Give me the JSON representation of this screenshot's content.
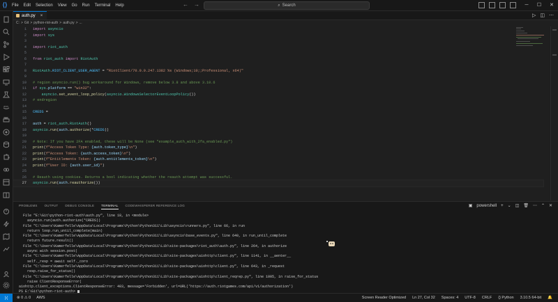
{
  "titlebar": {
    "menu": [
      "File",
      "Edit",
      "Selection",
      "View",
      "Go",
      "Run",
      "Terminal",
      "Help"
    ],
    "search_label": "Search"
  },
  "tab": {
    "filename": "auth.py"
  },
  "breadcrumb": [
    "C:",
    ">",
    "Git",
    ">",
    "python-riot-auth",
    ">",
    "auth.py",
    ">",
    "..."
  ],
  "editor": {
    "lines": [
      {
        "n": "1",
        "tokens": [
          {
            "c": "kw",
            "t": "import "
          },
          {
            "c": "mod",
            "t": "asyncio"
          }
        ]
      },
      {
        "n": "2",
        "tokens": [
          {
            "c": "kw",
            "t": "import "
          },
          {
            "c": "mod",
            "t": "sys"
          }
        ]
      },
      {
        "n": "3",
        "tokens": []
      },
      {
        "n": "4",
        "tokens": [
          {
            "c": "kw",
            "t": "import "
          },
          {
            "c": "mod",
            "t": "riot_auth"
          }
        ]
      },
      {
        "n": "5",
        "tokens": []
      },
      {
        "n": "6",
        "tokens": [
          {
            "c": "kw",
            "t": "from "
          },
          {
            "c": "mod",
            "t": "riot_auth "
          },
          {
            "c": "kw",
            "t": "import "
          },
          {
            "c": "mod",
            "t": "RiotAuth"
          }
        ]
      },
      {
        "n": "7",
        "tokens": []
      },
      {
        "n": "8",
        "tokens": [
          {
            "c": "mod",
            "t": "RiotAuth"
          },
          {
            "c": "pl",
            "t": "."
          },
          {
            "c": "con",
            "t": "RIOT_CLIENT_USER_AGENT"
          },
          {
            "c": "pl",
            "t": " = "
          },
          {
            "c": "str",
            "t": "\"RiotClient/70.0.0.247.1382 %s (Windows;10;;Professional, x64)\""
          }
        ]
      },
      {
        "n": "9",
        "tokens": []
      },
      {
        "n": "10",
        "tokens": [
          {
            "c": "cm",
            "t": "# region asyncio.run() bug workaround for Windows, remove below 3.8 and above 3.10.6"
          }
        ]
      },
      {
        "n": "11",
        "tokens": [
          {
            "c": "kw",
            "t": "if "
          },
          {
            "c": "mod",
            "t": "sys"
          },
          {
            "c": "pl",
            "t": "."
          },
          {
            "c": "var",
            "t": "platform"
          },
          {
            "c": "pl",
            "t": " == "
          },
          {
            "c": "str",
            "t": "\"win32\""
          },
          {
            "c": "pl",
            "t": ":"
          }
        ]
      },
      {
        "n": "12",
        "tokens": [
          {
            "c": "pl",
            "t": "    "
          },
          {
            "c": "mod",
            "t": "asyncio"
          },
          {
            "c": "pl",
            "t": "."
          },
          {
            "c": "fn",
            "t": "set_event_loop_policy"
          },
          {
            "c": "pl",
            "t": "("
          },
          {
            "c": "mod",
            "t": "asyncio"
          },
          {
            "c": "pl",
            "t": "."
          },
          {
            "c": "mod",
            "t": "WindowsSelectorEventLoopPolicy"
          },
          {
            "c": "pl",
            "t": "())"
          }
        ]
      },
      {
        "n": "13",
        "tokens": [
          {
            "c": "cm",
            "t": "# endregion"
          }
        ]
      },
      {
        "n": "14",
        "tokens": []
      },
      {
        "n": "15",
        "tokens": [
          {
            "c": "con",
            "t": "CREDS"
          },
          {
            "c": "pl",
            "t": " = "
          }
        ]
      },
      {
        "n": "16",
        "tokens": []
      },
      {
        "n": "17",
        "tokens": [
          {
            "c": "var",
            "t": "auth"
          },
          {
            "c": "pl",
            "t": " = "
          },
          {
            "c": "mod",
            "t": "riot_auth"
          },
          {
            "c": "pl",
            "t": "."
          },
          {
            "c": "mod",
            "t": "RiotAuth"
          },
          {
            "c": "pl",
            "t": "()"
          }
        ]
      },
      {
        "n": "18",
        "tokens": [
          {
            "c": "mod",
            "t": "asyncio"
          },
          {
            "c": "pl",
            "t": "."
          },
          {
            "c": "fn",
            "t": "run"
          },
          {
            "c": "pl",
            "t": "("
          },
          {
            "c": "var",
            "t": "auth"
          },
          {
            "c": "pl",
            "t": "."
          },
          {
            "c": "fn",
            "t": "authorize"
          },
          {
            "c": "pl",
            "t": "(*"
          },
          {
            "c": "con",
            "t": "CREDS"
          },
          {
            "c": "pl",
            "t": "))"
          }
        ]
      },
      {
        "n": "19",
        "tokens": []
      },
      {
        "n": "20",
        "tokens": [
          {
            "c": "cm",
            "t": "# Note: If you have 2FA enabled, these will be None (see \"example_auth_with_2fa_enabled.py\")"
          }
        ]
      },
      {
        "n": "21",
        "tokens": [
          {
            "c": "fn",
            "t": "print"
          },
          {
            "c": "pl",
            "t": "("
          },
          {
            "c": "str",
            "t": "f\"Access Token Type: "
          },
          {
            "c": "var",
            "t": "{auth.token_type}"
          },
          {
            "c": "str",
            "t": "\\n\""
          },
          {
            "c": "pl",
            "t": ")"
          }
        ]
      },
      {
        "n": "22",
        "tokens": [
          {
            "c": "fn",
            "t": "print"
          },
          {
            "c": "pl",
            "t": "("
          },
          {
            "c": "str",
            "t": "f\"Access Token: "
          },
          {
            "c": "var",
            "t": "{auth.access_token}"
          },
          {
            "c": "str",
            "t": "\\n\""
          },
          {
            "c": "pl",
            "t": ")"
          }
        ]
      },
      {
        "n": "23",
        "tokens": [
          {
            "c": "fn",
            "t": "print"
          },
          {
            "c": "pl",
            "t": "("
          },
          {
            "c": "str",
            "t": "f\"Entitlements Token: "
          },
          {
            "c": "var",
            "t": "{auth.entitlements_token}"
          },
          {
            "c": "str",
            "t": "\\n\""
          },
          {
            "c": "pl",
            "t": ")"
          }
        ]
      },
      {
        "n": "24",
        "tokens": [
          {
            "c": "fn",
            "t": "print"
          },
          {
            "c": "pl",
            "t": "("
          },
          {
            "c": "str",
            "t": "f\"User ID: "
          },
          {
            "c": "var",
            "t": "{auth.user_id}"
          },
          {
            "c": "str",
            "t": "\""
          },
          {
            "c": "pl",
            "t": ")"
          }
        ]
      },
      {
        "n": "25",
        "tokens": []
      },
      {
        "n": "26",
        "tokens": [
          {
            "c": "cm",
            "t": "# Reauth using cookies. Returns a bool indicating whether the reauth attempt was successful."
          }
        ]
      },
      {
        "n": "27",
        "tokens": [
          {
            "c": "mod",
            "t": "asyncio"
          },
          {
            "c": "pl",
            "t": "."
          },
          {
            "c": "fn",
            "t": "run"
          },
          {
            "c": "pl",
            "t": "("
          },
          {
            "c": "var",
            "t": "auth"
          },
          {
            "c": "pl",
            "t": "."
          },
          {
            "c": "fn",
            "t": "reauthorize"
          },
          {
            "c": "pl",
            "t": "())"
          }
        ],
        "current": true
      }
    ]
  },
  "panel": {
    "tabs": [
      "PROBLEMS",
      "OUTPUT",
      "DEBUG CONSOLE",
      "TERMINAL",
      "CODEWHISPERER REFERENCE LOG"
    ],
    "active_tab": "TERMINAL",
    "shell": "powershell",
    "terminal_lines": [
      "  File \"E:\\Git\\python-riot-auth\\auth.py\", line 18, in <module>",
      "    asyncio.run(auth.authorize(*CREDS))",
      "  File \"C:\\Users\\Kamerfelle\\AppData\\Local\\Programs\\Python\\Python311\\Lib\\asyncio\\runners.py\", line 66, in run",
      "    return loop.run_until_complete(main)",
      "  File \"C:\\Users\\Kamerfelle\\AppData\\Local\\Programs\\Python\\Python311\\Lib\\asyncio\\base_events.py\", line 640, in run_until_complete",
      "    return future.result()",
      "  File \"C:\\Users\\Kamerfelle\\AppData\\Local\\Programs\\Python\\Python311\\Lib\\site-packages\\riot_auth\\auth.py\", line 264, in authorize",
      "    async with session.post(",
      "  File \"C:\\Users\\Kamerfelle\\AppData\\Local\\Programs\\Python\\Python311\\Lib\\site-packages\\aiohttp\\client.py\", line 1141, in __aenter__",
      "    self._resp = await self._coro",
      "  File \"C:\\Users\\Kamerfelle\\AppData\\Local\\Programs\\Python\\Python311\\Lib\\site-packages\\aiohttp\\client.py\", line 643, in _request",
      "    resp.raise_for_status()",
      "  File \"C:\\Users\\Kamerfelle\\AppData\\Local\\Programs\\Python\\Python311\\Lib\\site-packages\\aiohttp\\client_reqrep.py\", line 1005, in raise_for_status",
      "    raise ClientResponseError(",
      "aiohttp.client_exceptions.ClientResponseError: 403, message='Forbidden', url=URL('https://auth.riotgames.com/api/v1/authorization')",
      "PS E:\\Git\\python-riot-auth> "
    ]
  },
  "statusbar": {
    "left": [
      "⊗ 0 ⚠ 0",
      "AWS"
    ],
    "right": [
      "Screen Reader Optimized",
      "Ln 27, Col 32",
      "Spaces: 4",
      "UTF-8",
      "CRLF",
      "{} Python",
      "3.10.5 64-bit"
    ]
  },
  "colors": {
    "accent": "#0078d4",
    "editor_bg": "#1f1f1f",
    "chrome_bg": "#181818"
  }
}
